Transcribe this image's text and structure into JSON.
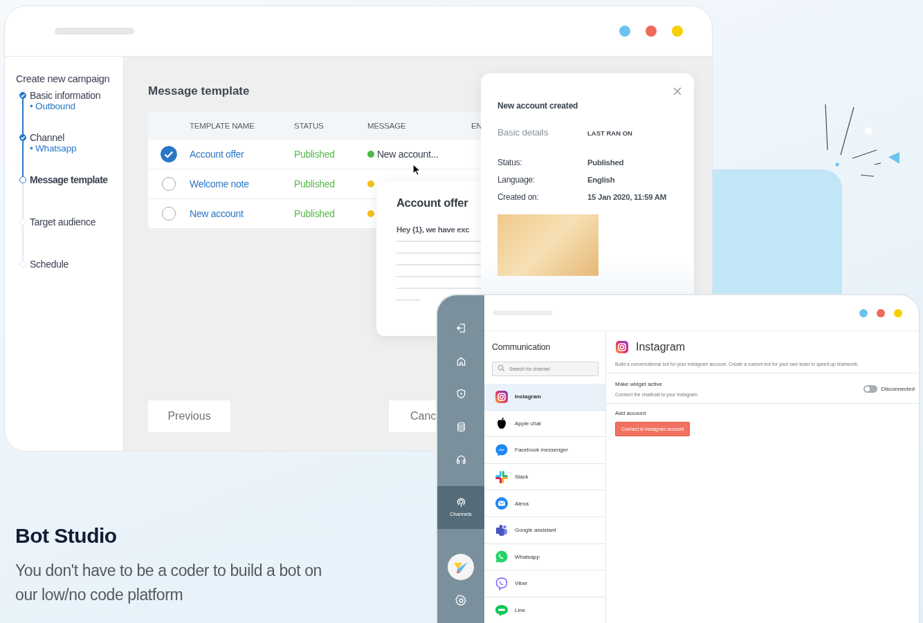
{
  "campaign_window": {
    "steps_title": "Create new campaign",
    "steps": [
      {
        "label": "Basic information",
        "value": "• Outbound",
        "done": true,
        "selected": false
      },
      {
        "label": "Channel",
        "value": "• Whatsapp",
        "done": true,
        "selected": false
      },
      {
        "label": "Message template",
        "done": false,
        "selected": true
      },
      {
        "label": "Target audience",
        "done": false,
        "selected": false
      },
      {
        "label": "Schedule",
        "done": false,
        "selected": false
      }
    ],
    "heading": "Message template",
    "table": {
      "columns": [
        "TEMPLATE NAME",
        "STATUS",
        "MESSAGE",
        "EN"
      ],
      "rows": [
        {
          "name": "Account offer",
          "status": "Published",
          "message": "New account...",
          "color": "#4cb84c",
          "selected": true
        },
        {
          "name": "Welcome note",
          "status": "Published",
          "color": "#f1c21b",
          "selected": false
        },
        {
          "name": "New account",
          "status": "Published",
          "color": "#f1c21b",
          "selected": false
        }
      ]
    },
    "buttons": [
      "Previous",
      "Canc"
    ]
  },
  "preview_card": {
    "title": "Account offer",
    "text": "Hey {1}, we have exc"
  },
  "details_popup": {
    "title": "New account created",
    "section": "Basic details",
    "column_label": "LAST RAN ON",
    "fields": [
      {
        "label": "Status:",
        "value": "Published"
      },
      {
        "label": "Language:",
        "value": "English"
      },
      {
        "label": "Created on:",
        "value": "15 Jan 2020, 11:59 AM"
      }
    ]
  },
  "channels_window": {
    "nav": [
      {
        "kind": "exit",
        "selected": false
      },
      {
        "kind": "home",
        "selected": false
      },
      {
        "kind": "shield",
        "selected": false
      },
      {
        "kind": "database",
        "selected": false
      },
      {
        "kind": "headset",
        "selected": false
      },
      {
        "kind": "channels",
        "label": "Channels",
        "selected": true
      }
    ],
    "list_title": "Communication",
    "search": {
      "placeholder": "Search for channel"
    },
    "channels": [
      {
        "name": "Instagram",
        "kind": "instagram",
        "selected": true
      },
      {
        "name": "Apple chat",
        "kind": "apple",
        "selected": false
      },
      {
        "name": "Facebook messenger",
        "kind": "messenger",
        "selected": false
      },
      {
        "name": "Slack",
        "kind": "slack",
        "selected": false
      },
      {
        "name": "Alexa",
        "kind": "mail",
        "selected": false
      },
      {
        "name": "Google assistant",
        "kind": "teams",
        "selected": false
      },
      {
        "name": "Whatsapp",
        "kind": "whatsapp",
        "selected": false
      },
      {
        "name": "Viber",
        "kind": "viber",
        "selected": false
      },
      {
        "name": "Line",
        "kind": "line",
        "selected": false
      }
    ],
    "detail": {
      "title": "Instagram",
      "description": "Build a conversational bot for your instagram account. Create a custom bot for your own team to speed up teamwork.",
      "widget_title": "Make widget active",
      "widget_subtitle": "Connect the chatboat to your instagram",
      "widget_on": false,
      "widget_status": "Disconnected",
      "account_title": "Add account",
      "connect_button": "Connect to instagram account"
    }
  },
  "hero": {
    "title": "Bot Studio",
    "subtitle": "You don't have to be a coder to build a bot on our low/no code platform"
  }
}
